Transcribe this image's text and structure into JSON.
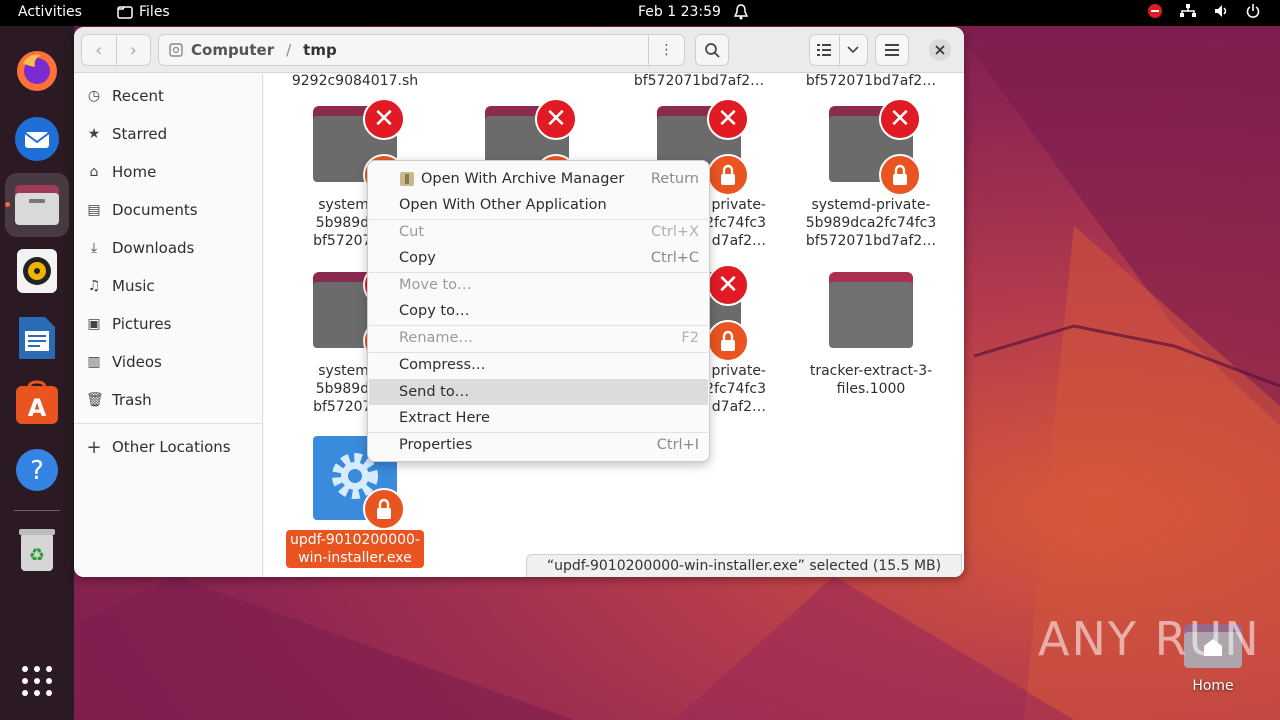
{
  "topbar": {
    "activities": "Activities",
    "app_name": "Files",
    "clock": "Feb 1  23:59"
  },
  "window": {
    "path": {
      "root": "Computer",
      "separator": "/",
      "current": "tmp"
    }
  },
  "sidebar": {
    "items": [
      {
        "label": "Recent",
        "icon": "clock-icon"
      },
      {
        "label": "Starred",
        "icon": "star-icon"
      },
      {
        "label": "Home",
        "icon": "home-icon"
      },
      {
        "label": "Documents",
        "icon": "document-icon"
      },
      {
        "label": "Downloads",
        "icon": "download-icon"
      },
      {
        "label": "Music",
        "icon": "music-icon"
      },
      {
        "label": "Pictures",
        "icon": "picture-icon"
      },
      {
        "label": "Videos",
        "icon": "video-icon"
      },
      {
        "label": "Trash",
        "icon": "trash-icon"
      }
    ],
    "other_locations": "Other Locations"
  },
  "files": {
    "top_partial": [
      "9292c9084017.sh",
      "bf572071bd7af2…",
      "bf572071bd7af2…"
    ],
    "row1": [
      {
        "line1": "systemd-p",
        "line2": "5b989dca2",
        "line3": "bf572071bc"
      },
      {
        "line1": "",
        "line2": "",
        "line3": ""
      },
      {
        "line1": "private-",
        "line2": "2fc74fc3",
        "line3": "d7af2…"
      },
      {
        "line1": "systemd-private-",
        "line2": "5b989dca2fc74fc3",
        "line3": "bf572071bd7af2…"
      }
    ],
    "row2": [
      {
        "line1": "systemd-p",
        "line2": "5b989dca2",
        "line3": "bf572071bc"
      },
      {
        "line1": "private-",
        "line2": "2fc74fc3",
        "line3": "d7af2…"
      },
      {
        "line1": "tracker-extract-3-",
        "line2": "files.1000"
      }
    ],
    "selected": {
      "line1": "updf-9010200000-",
      "line2": "win-installer.exe"
    }
  },
  "status": "“updf-9010200000-win-installer.exe” selected  (15.5 MB)",
  "context_menu": {
    "items": [
      {
        "label": "Open With Archive Manager",
        "accel": "Return",
        "disabled": false
      },
      {
        "label": "Open With Other Application",
        "accel": "",
        "disabled": false
      },
      {
        "label": "Cut",
        "accel": "Ctrl+X",
        "disabled": true
      },
      {
        "label": "Copy",
        "accel": "Ctrl+C",
        "disabled": false
      },
      {
        "label": "Move to…",
        "accel": "",
        "disabled": true
      },
      {
        "label": "Copy to…",
        "accel": "",
        "disabled": false
      },
      {
        "label": "Rename…",
        "accel": "F2",
        "disabled": true
      },
      {
        "label": "Compress…",
        "accel": "",
        "disabled": false
      },
      {
        "label": "Send to…",
        "accel": "",
        "disabled": false
      },
      {
        "label": "Extract Here",
        "accel": "",
        "disabled": false
      },
      {
        "label": "Properties",
        "accel": "Ctrl+I",
        "disabled": false
      }
    ]
  },
  "desktop": {
    "home_label": "Home",
    "watermark": "ANY RUN"
  },
  "colors": {
    "accent": "#e95420",
    "error": "#e01b24",
    "folder_tab": "#8b2a4f"
  }
}
